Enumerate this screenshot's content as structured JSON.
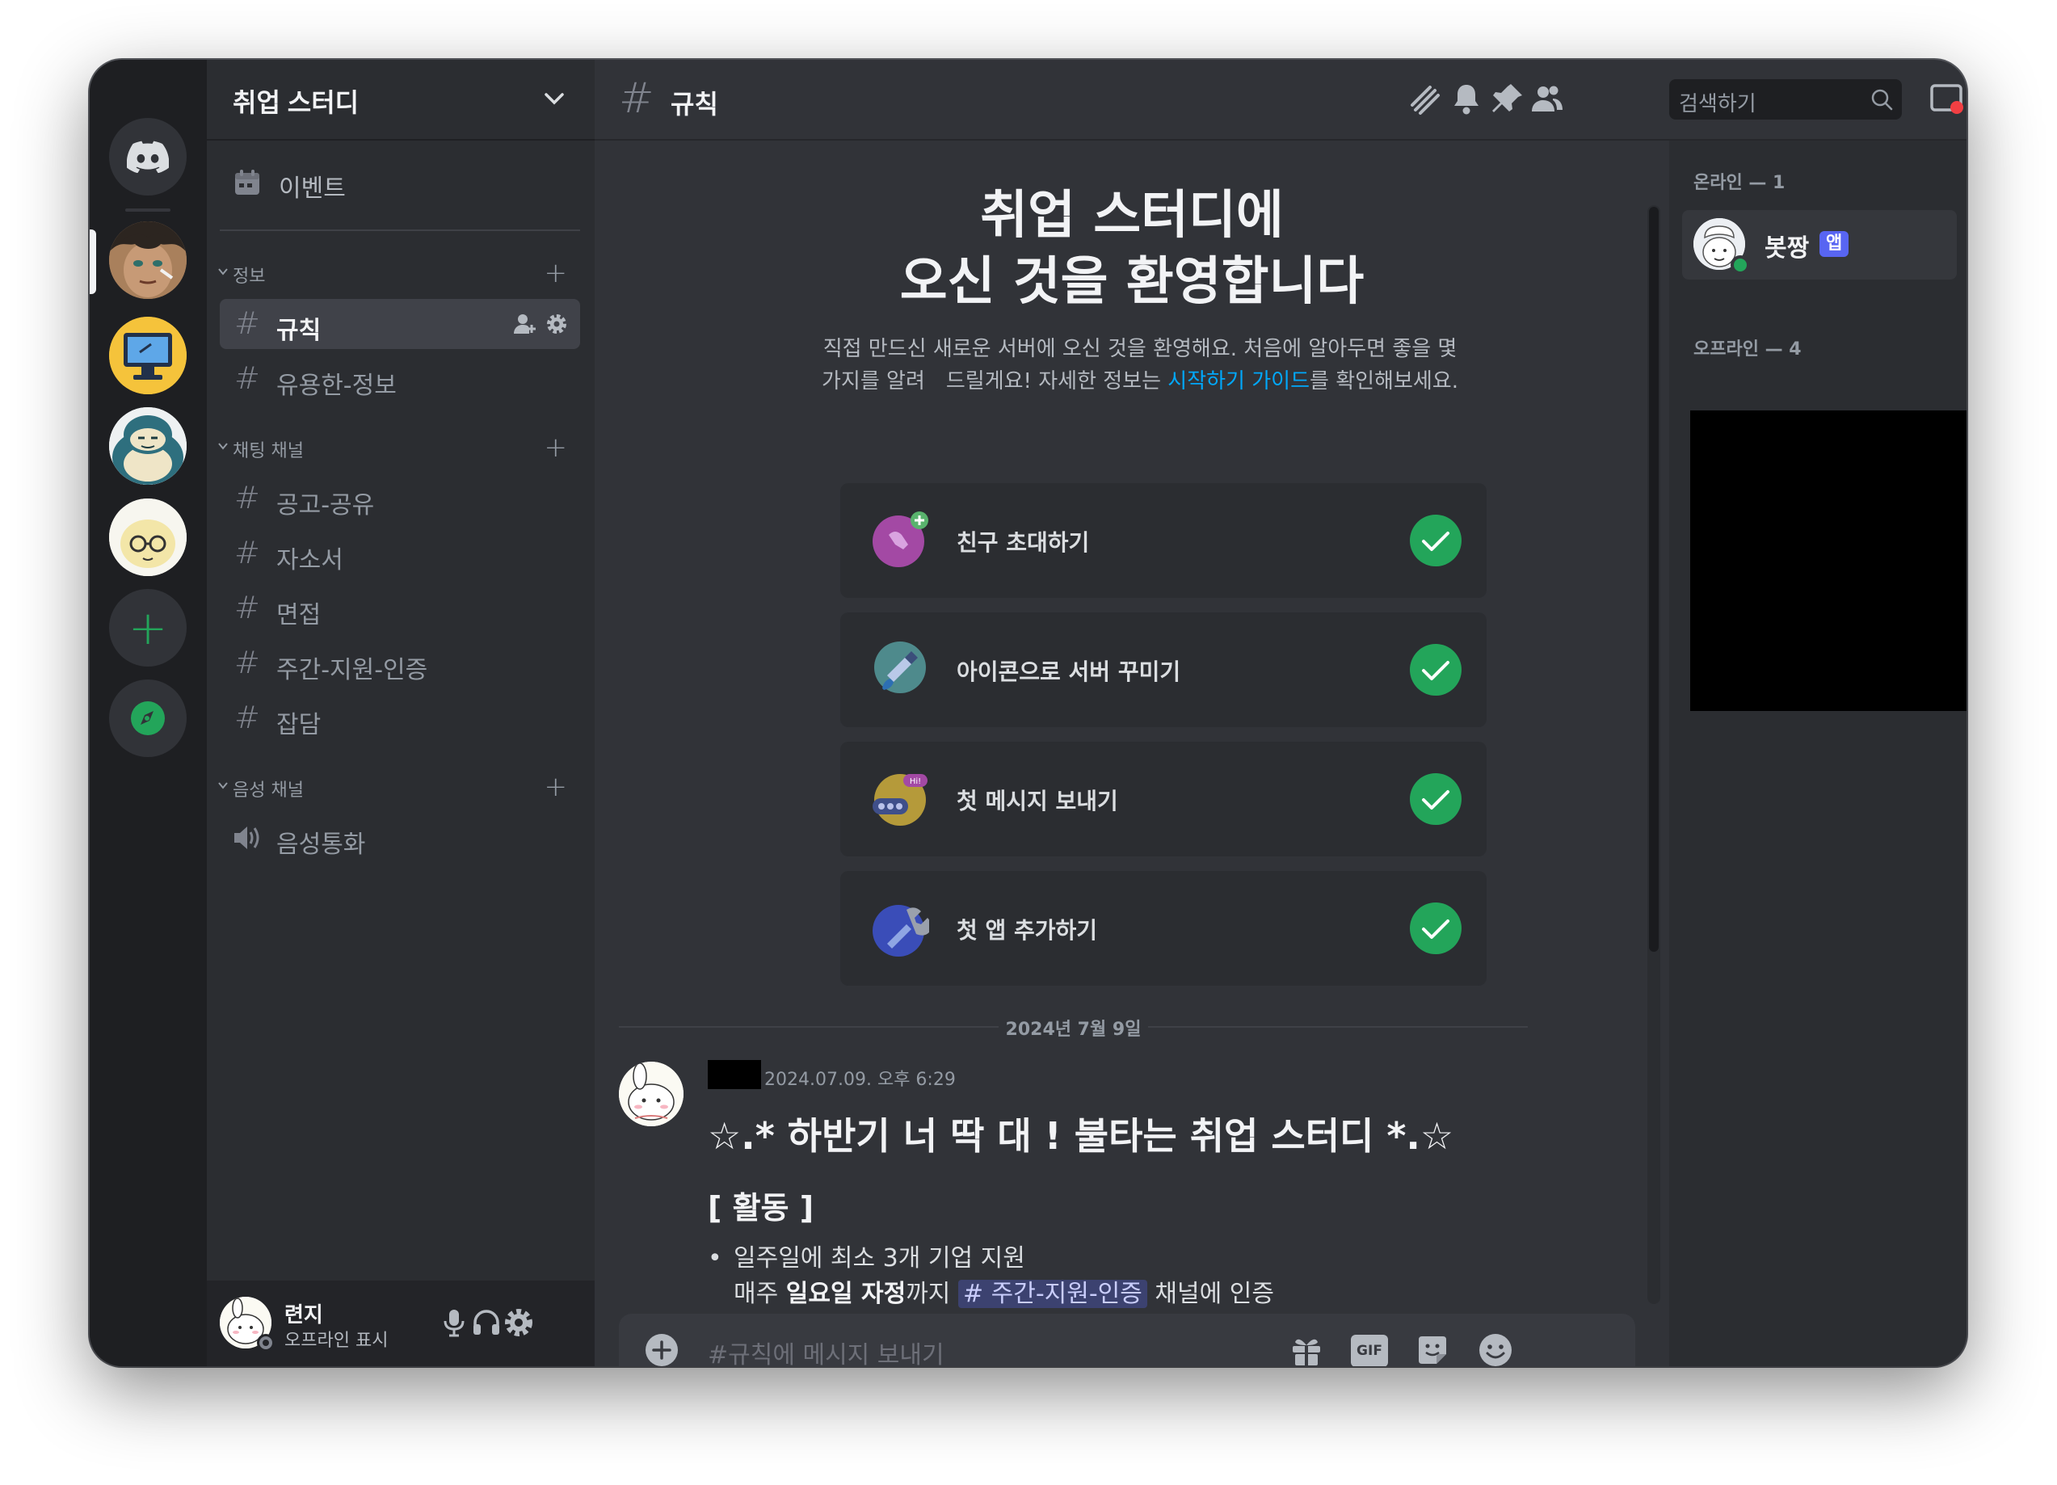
{
  "server": {
    "name": "취업 스터디",
    "events_label": "이벤트"
  },
  "categories": [
    {
      "label": "정보",
      "channels": [
        "규칙",
        "유용한-정보"
      ]
    },
    {
      "label": "채팅 채널",
      "channels": [
        "공고-공유",
        "자소서",
        "면접",
        "주간-지원-인증",
        "잡담"
      ]
    },
    {
      "label": "음성 채널",
      "channels": [
        "음성통화"
      ]
    }
  ],
  "active_channel": "규칙",
  "header": {
    "hash": "#",
    "channel_title": "규칙",
    "search_placeholder": "검색하기",
    "icons": [
      "threads-icon",
      "bell-icon",
      "pin-icon",
      "members-icon",
      "inbox-icon",
      "help-icon"
    ]
  },
  "welcome": {
    "title_line1": "취업 스터디에",
    "title_line2": "오신 것을 환영합니다",
    "desc_line1": "직접 만드신 새로운 서버에 오신 것을 환영해요. 처음에 알아두면 좋을 몇",
    "desc_line2_pre": "가지를 알려　드릴게요! 자세한 정보는 ",
    "desc_link": "시작하기 가이드",
    "desc_line2_post": "를 확인해보세요.",
    "cards": [
      {
        "label": "친구 초대하기",
        "done": true
      },
      {
        "label": "아이콘으로 서버 꾸미기",
        "done": true
      },
      {
        "label": "첫 메시지 보내기",
        "done": true
      },
      {
        "label": "첫 앱 추가하기",
        "done": true
      }
    ]
  },
  "date_divider": "2024년 7월 9일",
  "message": {
    "timestamp": "2024.07.09. 오후 6:29",
    "heading": "☆.* 하반기 너 딱 대 ! 불타는 취업 스터디 *.☆",
    "subheading": "[ 활동 ]",
    "bullet_line1": "일주일에 최소 3개 기업 지원",
    "bullet_line2_pre": "매주 ",
    "bullet_line2_bold": "일요일 자정",
    "bullet_line2_mid": "까지 ",
    "bullet_line2_mention": "# 주간-지원-인증",
    "bullet_line2_post": " 채널에 인증"
  },
  "composer": {
    "placeholder": "#규칙에 메시지 보내기",
    "gif_label": "GIF"
  },
  "user_panel": {
    "name": "련지",
    "status": "오프라인 표시"
  },
  "members": {
    "online_header": "온라인 — 1",
    "offline_header": "오프라인 — 4",
    "online": [
      {
        "name": "봇짱",
        "badge": "앱"
      }
    ]
  },
  "colors": {
    "accent": "#5865f2",
    "success": "#23a55a",
    "link": "#00a8fc"
  }
}
